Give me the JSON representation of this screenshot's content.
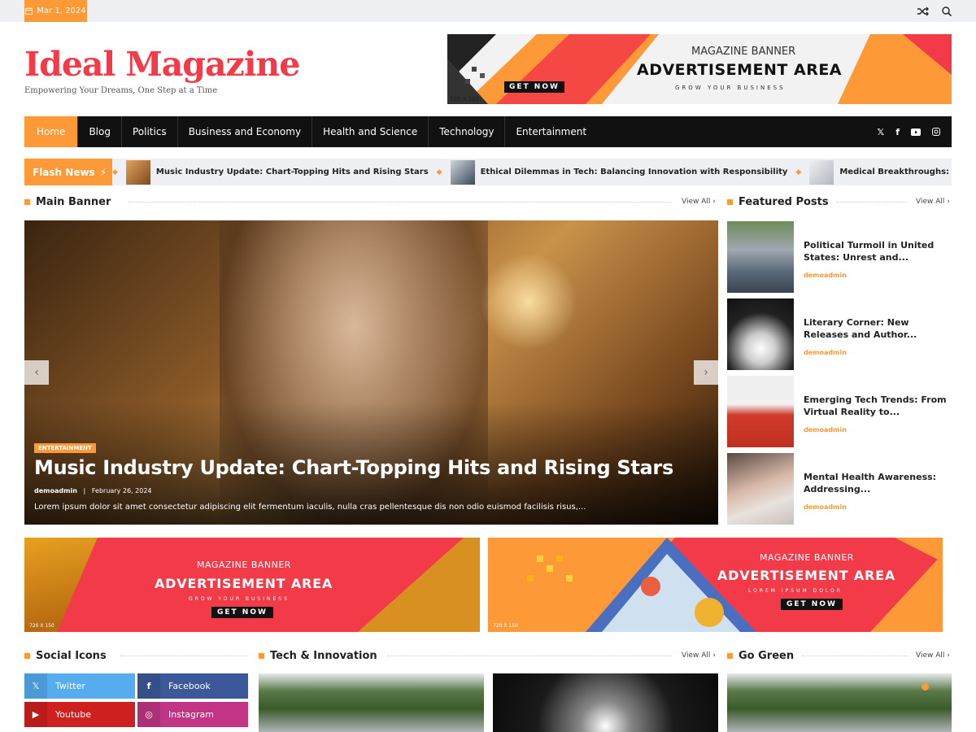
{
  "topbar": {
    "date": "Mar 1, 2024",
    "icons": [
      "shuffle-icon",
      "search-icon"
    ]
  },
  "site": {
    "title": "Ideal Magazine",
    "tagline": "Empowering Your Dreams, One Step at a Time"
  },
  "header_ad": {
    "line1": "MAGAZINE BANNER",
    "line2": "ADVERTISEMENT AREA",
    "line3": "GROW YOUR BUSINESS",
    "cta": "GET NOW",
    "size": "720 X 100"
  },
  "nav": {
    "items": [
      "Home",
      "Blog",
      "Politics",
      "Business and Economy",
      "Health and Science",
      "Technology",
      "Entertainment"
    ],
    "social": [
      "x-icon",
      "facebook-icon",
      "youtube-icon",
      "instagram-icon"
    ]
  },
  "flash": {
    "label": "Flash News",
    "items": [
      "Music Industry Update: Chart-Topping Hits and Rising Stars",
      "Ethical Dilemmas in Tech: Balancing Innovation with Responsibility",
      "Medical Breakthroughs: Re"
    ]
  },
  "sections": {
    "main_banner": "Main Banner",
    "featured": "Featured Posts",
    "social": "Social Icons",
    "tech": "Tech & Innovation",
    "green": "Go Green",
    "view_all": "View All"
  },
  "banner": {
    "category": "ENTERTAINMENT",
    "title": "Music Industry Update: Chart-Topping Hits and Rising Stars",
    "author": "demoadmin",
    "separator": "|",
    "date": "February 26, 2024",
    "excerpt": "Lorem ipsum dolor sit amet consectetur adipiscing elit fermentum iaculis, nulla cras pellentesque dis non odio euismod facilisis risus,..."
  },
  "featured": [
    {
      "title": "Political Turmoil in United States: Unrest and...",
      "author": "demoadmin"
    },
    {
      "title": "Literary Corner: New Releases and Author...",
      "author": "demoadmin"
    },
    {
      "title": "Emerging Tech Trends: From Virtual Reality to...",
      "author": "demoadmin"
    },
    {
      "title": "Mental Health Awareness: Addressing...",
      "author": "demoadmin"
    }
  ],
  "ads": [
    {
      "line1": "MAGAZINE BANNER",
      "line2": "ADVERTISEMENT AREA",
      "line3": "GROW YOUR BUSINESS",
      "cta": "GET NOW",
      "size": "720 X 150"
    },
    {
      "line1": "MAGAZINE BANNER",
      "line2": "ADVERTISEMENT AREA",
      "line3": "LOREM IPSUM DOLOR",
      "cta": "GET NOW",
      "size": "720 X 150"
    }
  ],
  "social_buttons": [
    {
      "label": "Twitter",
      "icon": "x-icon",
      "color": "#55acee"
    },
    {
      "label": "Facebook",
      "icon": "facebook-icon",
      "color": "#3b5998"
    },
    {
      "label": "Youtube",
      "icon": "youtube-icon",
      "color": "#cd201f"
    },
    {
      "label": "Instagram",
      "icon": "instagram-icon",
      "color": "#c13584"
    }
  ],
  "colors": {
    "accent": "#fd9936",
    "brand": "#f33a48",
    "nav": "#111111"
  }
}
